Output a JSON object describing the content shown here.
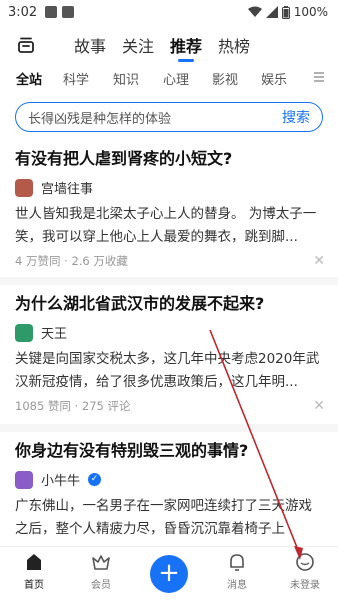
{
  "status_bar": {
    "time": "3:02",
    "battery": "100%"
  },
  "top_tabs": [
    {
      "label": "故事",
      "active": false
    },
    {
      "label": "关注",
      "active": false
    },
    {
      "label": "推荐",
      "active": true
    },
    {
      "label": "热榜",
      "active": false
    }
  ],
  "categories": [
    {
      "label": "全站",
      "active": true
    },
    {
      "label": "科学",
      "active": false
    },
    {
      "label": "知识",
      "active": false
    },
    {
      "label": "心理",
      "active": false
    },
    {
      "label": "影视",
      "active": false
    },
    {
      "label": "娱乐",
      "active": false
    }
  ],
  "search": {
    "placeholder": "长得凶残是种怎样的体验",
    "button": "搜索"
  },
  "feed": [
    {
      "title": "有没有把人虐到肾疼的小短文?",
      "author": "宫墙往事",
      "excerpt": "世人皆知我是北梁太子心上人的替身。 为博太子一笑，我可以穿上他心上人最爱的舞衣，跳到脚...",
      "meta": "4 万赞同 · 2.6 万收藏"
    },
    {
      "title": "为什么湖北省武汉市的发展不起来?",
      "author": "天王",
      "excerpt": "关键是向国家交税太多，这几年中央考虑2020年武汉新冠疫情，给了很多优惠政策后，这几年明...",
      "meta": "1085 赞同 · 275 评论"
    },
    {
      "title": "你身边有没有特别毁三观的事情?",
      "author": "小牛牛",
      "excerpt": "广东佛山，一名男子在一家网吧连续打了三天游戏之后，整个人精疲力尽，昏昏沉沉靠着椅子上",
      "meta": ""
    }
  ],
  "bottom_nav": [
    {
      "label": "首页",
      "icon": "home-icon",
      "active": true
    },
    {
      "label": "会员",
      "icon": "vip-icon",
      "active": false
    },
    {
      "label": "",
      "icon": "plus-icon",
      "active": false
    },
    {
      "label": "消息",
      "icon": "bell-icon",
      "active": false
    },
    {
      "label": "未登录",
      "icon": "profile-icon",
      "active": false
    }
  ],
  "colors": {
    "accent": "#1772f6",
    "annotation": "#c0262d"
  }
}
